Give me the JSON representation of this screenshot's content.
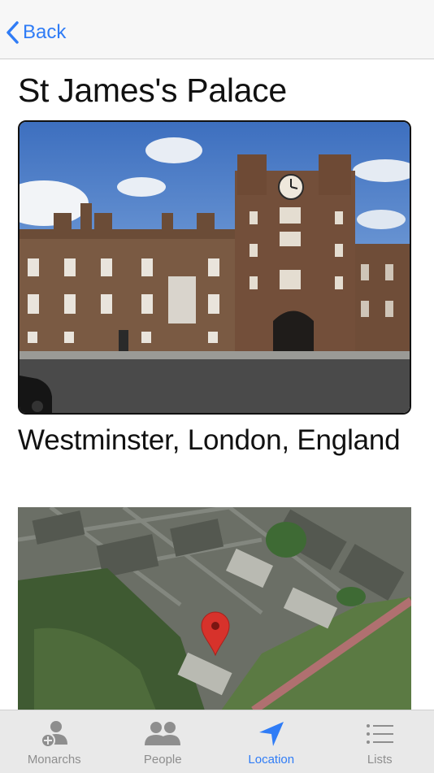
{
  "nav": {
    "back_label": "Back"
  },
  "page": {
    "title": "St James's Palace",
    "location": "Westminster, London, England"
  },
  "tabs": [
    {
      "label": "Monarchs",
      "icon": "person-add-icon",
      "active": false
    },
    {
      "label": "People",
      "icon": "people-icon",
      "active": false
    },
    {
      "label": "Location",
      "icon": "location-arrow-icon",
      "active": true
    },
    {
      "label": "Lists",
      "icon": "list-icon",
      "active": false
    }
  ],
  "colors": {
    "accent": "#2f7cf6",
    "inactive": "#8e8e8e",
    "map_pin": "#d7322b"
  }
}
